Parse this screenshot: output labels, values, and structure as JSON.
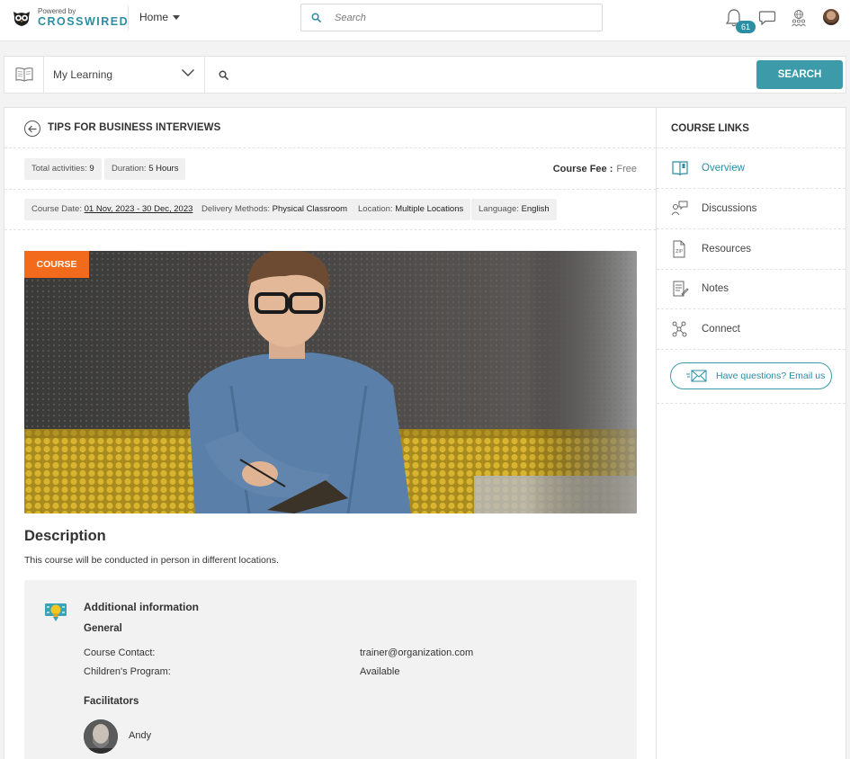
{
  "brand": {
    "powered_by": "Powered by",
    "name": "CROSSWIRED"
  },
  "nav": {
    "home_label": "Home",
    "search_placeholder": "Search",
    "notification_count": "61"
  },
  "learn_bar": {
    "select_value": "My Learning",
    "search_placeholder": "",
    "search_button": "SEARCH"
  },
  "course": {
    "title": "TIPS FOR BUSINESS INTERVIEWS",
    "total_activities_label": "Total activities:",
    "total_activities": "9",
    "duration_label": "Duration:",
    "duration": "5 Hours",
    "fee_label": "Course Fee :",
    "fee": "Free",
    "date_label": "Course Date:",
    "date": "01 Nov, 2023 - 30 Dec, 2023",
    "delivery_label": "Delivery Methods:",
    "delivery": "Physical Classroom",
    "location_label": "Location:",
    "location": "Multiple Locations",
    "language_label": "Language:",
    "language": "English",
    "tag": "COURSE",
    "description_title": "Description",
    "description": "This course will be conducted in person in different locations."
  },
  "additional_info": {
    "title": "Additional information",
    "section": "General",
    "rows": [
      {
        "label": "Course Contact:",
        "value": "trainer@organization.com"
      },
      {
        "label": "Children's Program:",
        "value": "Available"
      }
    ],
    "facilitators_title": "Facilitators",
    "facilitators": [
      {
        "name": "Andy"
      }
    ]
  },
  "sidebar": {
    "title": "COURSE LINKS",
    "items": [
      {
        "label": "Overview",
        "icon": "book-open-icon"
      },
      {
        "label": "Discussions",
        "icon": "discussion-icon"
      },
      {
        "label": "Resources",
        "icon": "zip-file-icon"
      },
      {
        "label": "Notes",
        "icon": "notes-icon"
      },
      {
        "label": "Connect",
        "icon": "network-icon"
      }
    ],
    "email_button": "Have questions? Email us"
  },
  "colors": {
    "accent": "#2b8ea3",
    "search_button": "#3d9aa9",
    "course_tag": "#f26a1b"
  }
}
